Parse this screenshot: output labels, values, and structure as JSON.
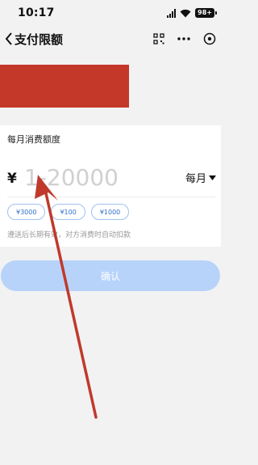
{
  "status_bar": {
    "time": "10:17",
    "battery": "98+"
  },
  "nav": {
    "title": "支付限额",
    "icons": [
      "chevron-left-icon",
      "scan-icon",
      "more-icon",
      "target-icon"
    ]
  },
  "colors": {
    "accent": "#2f6fc8",
    "button_disabled": "#b8d3fa",
    "redaction": "#c4382a",
    "arrow": "#c0392b"
  },
  "card": {
    "label": "每月消费额度",
    "currency": "¥",
    "amount_value": "",
    "amount_placeholder": "1-20000",
    "period": "每月",
    "chips": [
      "¥3000",
      "¥100",
      "¥1000"
    ],
    "hint": "遵送后长期有效，对方消费时自动扣款"
  },
  "confirm_button": "确认"
}
